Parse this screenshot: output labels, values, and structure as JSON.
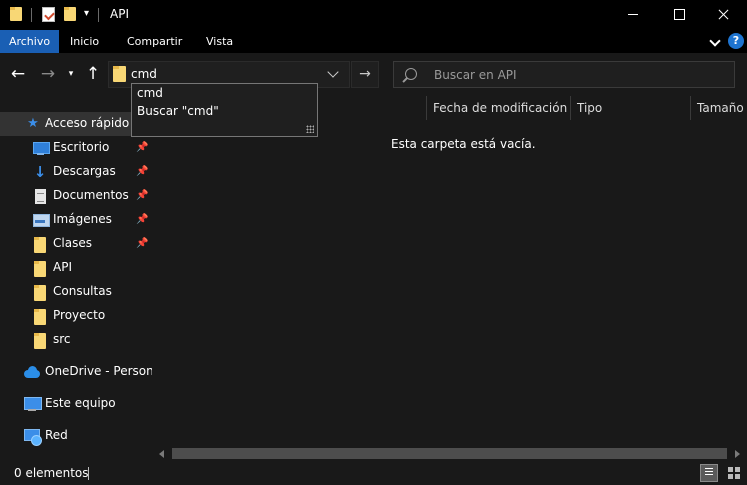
{
  "window": {
    "title": "API",
    "qa_dropdown_glyph": "▾"
  },
  "ribbon": {
    "tabs": [
      "Archivo",
      "Inicio",
      "Compartir",
      "Vista"
    ],
    "help_glyph": "?"
  },
  "nav": {
    "address_value": "cmd",
    "search_placeholder": "Buscar en API",
    "back_glyph": "←",
    "forward_glyph": "→",
    "recent_glyph": "▾",
    "up_glyph": "↑",
    "go_glyph": "→"
  },
  "autocomplete": {
    "items": [
      "cmd",
      "Buscar \"cmd\""
    ]
  },
  "sidebar": {
    "items": [
      {
        "label": "Acceso rápido",
        "icon": "star-icon",
        "selected": true
      },
      {
        "label": "Escritorio",
        "icon": "desktop-icon",
        "pinned": true
      },
      {
        "label": "Descargas",
        "icon": "download-icon",
        "pinned": true
      },
      {
        "label": "Documentos",
        "icon": "documents-icon",
        "pinned": true
      },
      {
        "label": "Imágenes",
        "icon": "images-icon",
        "pinned": true
      },
      {
        "label": "Clases",
        "icon": "folder-icon",
        "pinned": true
      },
      {
        "label": "API",
        "icon": "folder-icon"
      },
      {
        "label": "Consultas",
        "icon": "folder-icon"
      },
      {
        "label": "Proyecto",
        "icon": "folder-icon"
      },
      {
        "label": "src",
        "icon": "folder-icon"
      },
      {
        "label": "OneDrive - Personal",
        "icon": "onedrive-icon"
      },
      {
        "label": "Este equipo",
        "icon": "this-pc-icon"
      },
      {
        "label": "Red",
        "icon": "network-icon"
      }
    ]
  },
  "content": {
    "columns": [
      "Fecha de modificación",
      "Tipo",
      "Tamaño"
    ],
    "empty_message": "Esta carpeta está vacía."
  },
  "status": {
    "item_count": "0 elementos"
  },
  "colors": {
    "accent": "#1a5fb4",
    "background": "#191919",
    "titlebar": "#000000",
    "folder": "#f8d775"
  }
}
